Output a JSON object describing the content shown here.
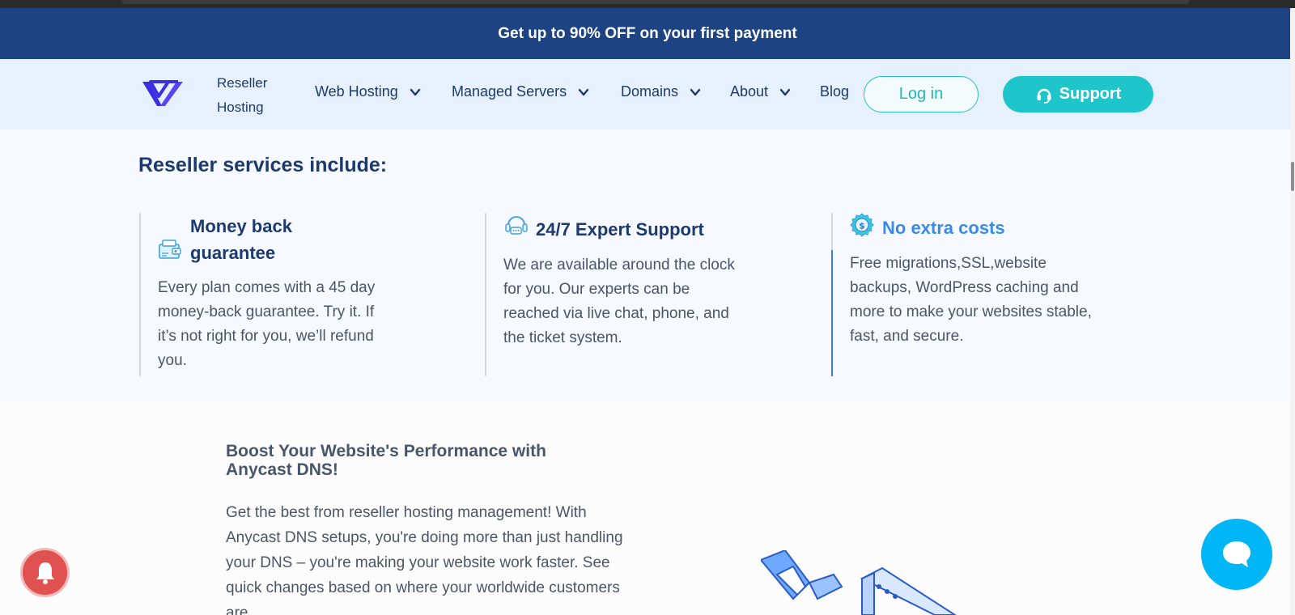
{
  "promo": {
    "text": "Get up to 90% OFF on your first payment"
  },
  "nav": {
    "brand_line1": "Reseller",
    "brand_line2": "Hosting",
    "items": [
      {
        "label": "Web Hosting"
      },
      {
        "label": "Managed Servers"
      },
      {
        "label": "Domains"
      },
      {
        "label": "About"
      },
      {
        "label": "Blog"
      }
    ],
    "login_label": "Log in",
    "support_label": "Support"
  },
  "services": {
    "heading": "Reseller services include:",
    "cards": [
      {
        "title_line1": "Money back",
        "title_line2": "guarantee",
        "icon": "wallet-icon",
        "desc": "Every plan comes with a 45 day money-back guarantee. Try it. If it’s not right for you, we’ll refund you."
      },
      {
        "title": "24/7 Expert Support",
        "icon": "headset-icon",
        "desc": "We are available around the clock for you. Our experts can be reached via live chat, phone, and the ticket system."
      },
      {
        "title": "No extra costs",
        "icon": "dollar-badge-icon",
        "desc": "Free migrations,SSL,website backups, WordPress caching and more to make your websites stable, fast, and secure."
      }
    ]
  },
  "boost": {
    "title": "Boost Your Website's Performance with Anycast DNS!",
    "text": "Get the best from reseller hosting management! With Anycast DNS setups, you're doing more than just handling your DNS – you're making your website work faster. See quick changes based on where your worldwide customers are."
  },
  "colors": {
    "promo_bg": "#1d4382",
    "accent_teal": "#1ec6cc",
    "chat_blue": "#00b6f7",
    "bell_red": "#e05252"
  }
}
